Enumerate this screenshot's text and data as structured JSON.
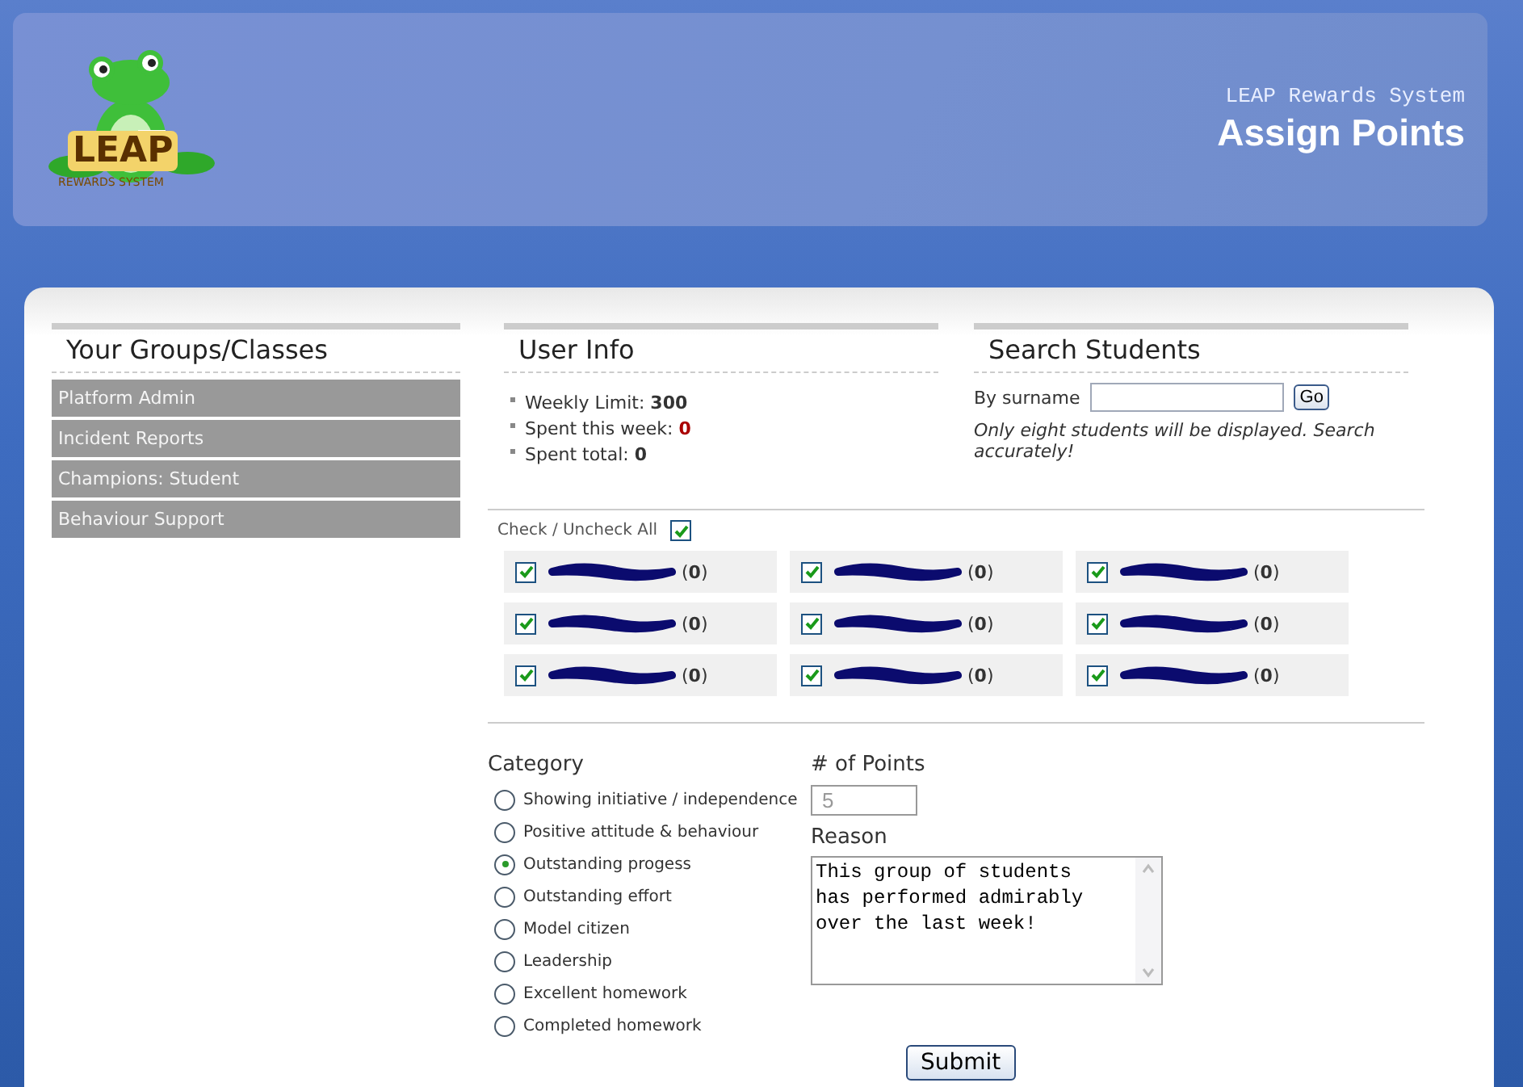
{
  "header": {
    "logo": {
      "word": "LEAP",
      "tagline": "REWARDS SYSTEM"
    },
    "system_name": "LEAP Rewards System",
    "title": "Assign Points"
  },
  "sidebar": {
    "title": "Your Groups/Classes",
    "items": [
      {
        "label": "Platform Admin"
      },
      {
        "label": "Incident Reports"
      },
      {
        "label": "Champions: Student"
      },
      {
        "label": "Behaviour Support"
      }
    ]
  },
  "user_info": {
    "title": "User Info",
    "stats": [
      {
        "label": "Weekly Limit:",
        "value": "300",
        "alert": false
      },
      {
        "label": "Spent this week:",
        "value": "0",
        "alert": true
      },
      {
        "label": "Spent total:",
        "value": "0",
        "alert": false
      }
    ]
  },
  "search": {
    "title": "Search Students",
    "label": "By surname",
    "button": "Go",
    "note": "Only eight students will be displayed. Search accurately!"
  },
  "students": {
    "check_all": {
      "label": "Check / Uncheck All",
      "checked": true
    },
    "items": [
      {
        "checked": true,
        "redacted": true,
        "points": "(**0**)"
      },
      {
        "checked": true,
        "redacted": true,
        "points": "(**0**)"
      },
      {
        "checked": true,
        "redacted": true,
        "points": "(**0**)"
      },
      {
        "checked": true,
        "redacted": true,
        "points": "(**0**)"
      },
      {
        "checked": true,
        "redacted": true,
        "points": "(**0**)"
      },
      {
        "checked": true,
        "redacted": true,
        "points": "(**0**)"
      },
      {
        "checked": true,
        "redacted": true,
        "points": "(**0**)"
      },
      {
        "checked": true,
        "redacted": true,
        "points": "(**0**)"
      },
      {
        "checked": true,
        "redacted": true,
        "points": "(**0**)"
      }
    ]
  },
  "category": {
    "title": "Category",
    "options": [
      {
        "label": "Showing initiative / independence",
        "selected": false
      },
      {
        "label": "Positive attitude & behaviour",
        "selected": false
      },
      {
        "label": "Outstanding progess",
        "selected": true
      },
      {
        "label": "Outstanding effort",
        "selected": false
      },
      {
        "label": "Model citizen",
        "selected": false
      },
      {
        "label": "Leadership",
        "selected": false
      },
      {
        "label": "Excellent homework",
        "selected": false
      },
      {
        "label": "Completed homework",
        "selected": false
      }
    ]
  },
  "points": {
    "label": "# of Points",
    "placeholder": "5"
  },
  "reason": {
    "label": "Reason",
    "value": "This group of students has performed admirably over the last week!"
  },
  "submit": "Submit"
}
